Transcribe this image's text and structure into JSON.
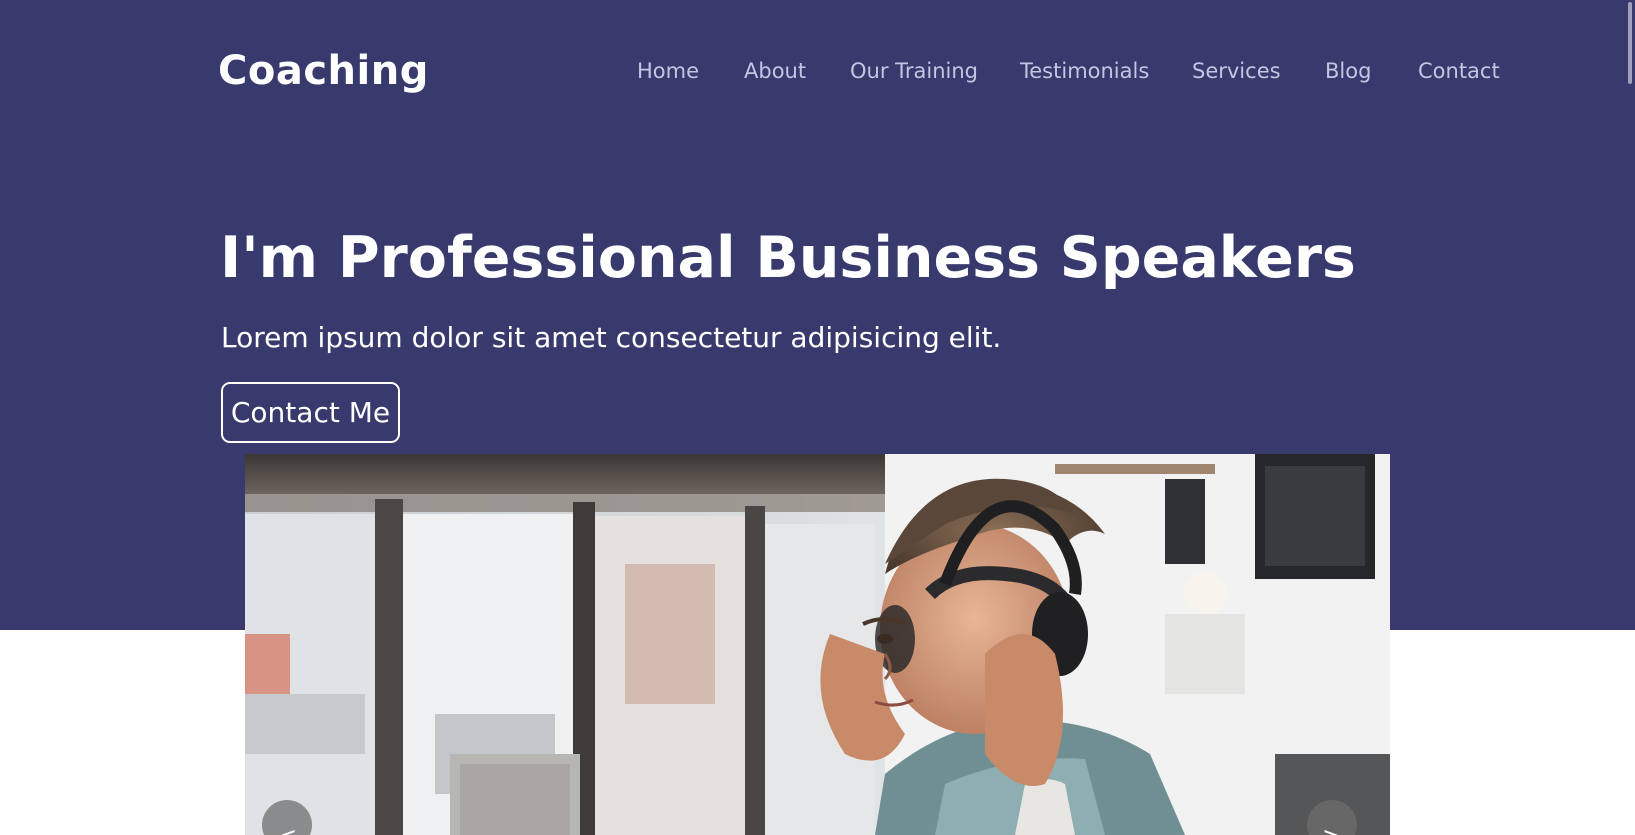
{
  "header": {
    "brand": "Coaching",
    "nav": [
      {
        "label": "Home"
      },
      {
        "label": "About"
      },
      {
        "label": "Our Training"
      },
      {
        "label": "Testimonials"
      },
      {
        "label": "Services"
      },
      {
        "label": "Blog"
      },
      {
        "label": "Contact"
      }
    ]
  },
  "hero": {
    "title": "I'm Professional Business Speakers",
    "subtitle": "Lorem ipsum dolor sit amet consectetur adipisicing elit.",
    "cta_label": "Contact Me"
  },
  "slider": {
    "prev_label": "<",
    "next_label": ">"
  },
  "colors": {
    "hero_background": "#38396c",
    "nav_text": "#c3c6e2",
    "heading_text": "#ffffff",
    "page_background": "#ffffff"
  },
  "icons": {
    "slider_prev": "chevron-left-icon",
    "slider_next": "chevron-right-icon"
  }
}
